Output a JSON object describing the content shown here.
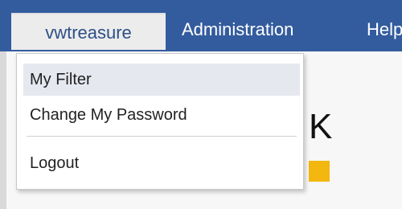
{
  "navbar": {
    "user": "vwtreasure",
    "admin": "Administration",
    "help": "Help"
  },
  "background": {
    "partial_text": "K"
  },
  "menu": {
    "items": [
      {
        "label": "My Filter"
      },
      {
        "label": "Change My Password"
      },
      {
        "label": "Logout"
      }
    ]
  },
  "colors": {
    "navbar": "#335c9e",
    "accent": "#f4b70f",
    "menu_highlight": "#e6e8f0"
  }
}
